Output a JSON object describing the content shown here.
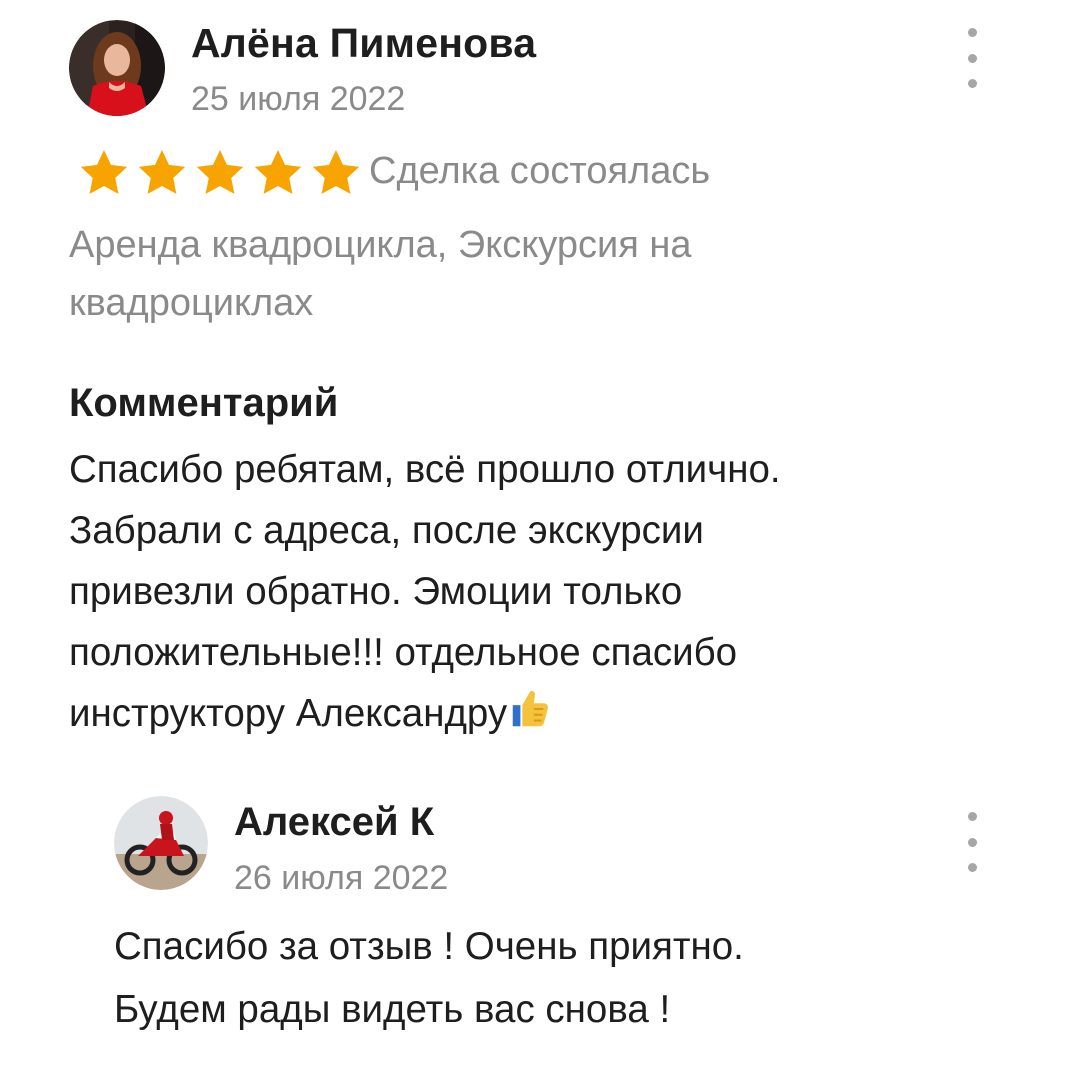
{
  "review": {
    "author": {
      "name": "Алёна Пименова",
      "avatar_icon": "user-photo-avatar"
    },
    "date": "25 июля 2022",
    "rating": {
      "value": 5,
      "max": 5,
      "star_color": "#F7A400"
    },
    "deal_status": "Сделка состоялась",
    "services_line1": "Аренда квадроцикла, Экскурсия на",
    "services_line2": "квадроциклах",
    "comment_heading": "Комментарий",
    "comment_lines": [
      "Спасибо ребятам, всё прошло отлично.",
      "Забрали с адреса, после экскурсии",
      "привезли обратно. Эмоции только",
      "положительные!!! отдельное спасибо",
      "инструктору Александру"
    ],
    "comment_emoji": "thumbs-up-icon",
    "menu_icon": "more-vertical-icon"
  },
  "reply": {
    "author": {
      "name": "Алексей К",
      "avatar_icon": "motorcycle-photo-avatar"
    },
    "date": "26 июля 2022",
    "text_lines": [
      "Спасибо за отзыв ! Очень приятно.",
      "Будем рады видеть вас снова !"
    ],
    "menu_icon": "more-vertical-icon"
  },
  "colors": {
    "text_primary": "#1E1E1E",
    "text_secondary": "#8A8A8A",
    "star": "#F7A400",
    "menu_dots": "#A6A6A6"
  }
}
